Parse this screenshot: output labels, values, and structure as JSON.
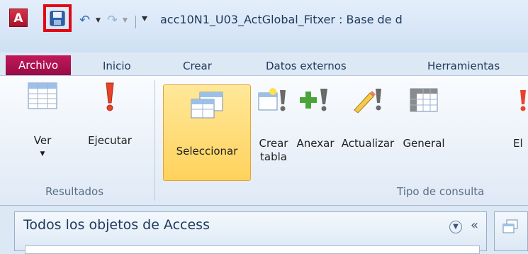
{
  "app": {
    "icon_letter": "A",
    "title": "acc10N1_U03_ActGlobal_Fitxer : Base de d"
  },
  "qat": {
    "save_icon": "save-icon",
    "undo_icon": "undo-icon",
    "redo_icon": "redo-icon",
    "customize_glyph": "|="
  },
  "tabs": [
    "Archivo",
    "Inicio",
    "Crear",
    "Datos externos",
    "Herramientas"
  ],
  "ribbon": {
    "results": {
      "ver": "Ver",
      "ejecutar": "Ejecutar",
      "label": "Resultados"
    },
    "query_type": {
      "seleccionar": "Seleccionar",
      "crear": "Crear",
      "tabla": "tabla",
      "anexar": "Anexar",
      "actualizar": "Actualizar",
      "general": "General",
      "el": "El",
      "label": "Tipo de consulta"
    }
  },
  "nav": {
    "title": "Todos los objetos de Access",
    "collapse": "«"
  },
  "colors": {
    "file_tab": "#b0124f",
    "highlight_box": "#e30613",
    "active_button": "#ffd25c"
  }
}
